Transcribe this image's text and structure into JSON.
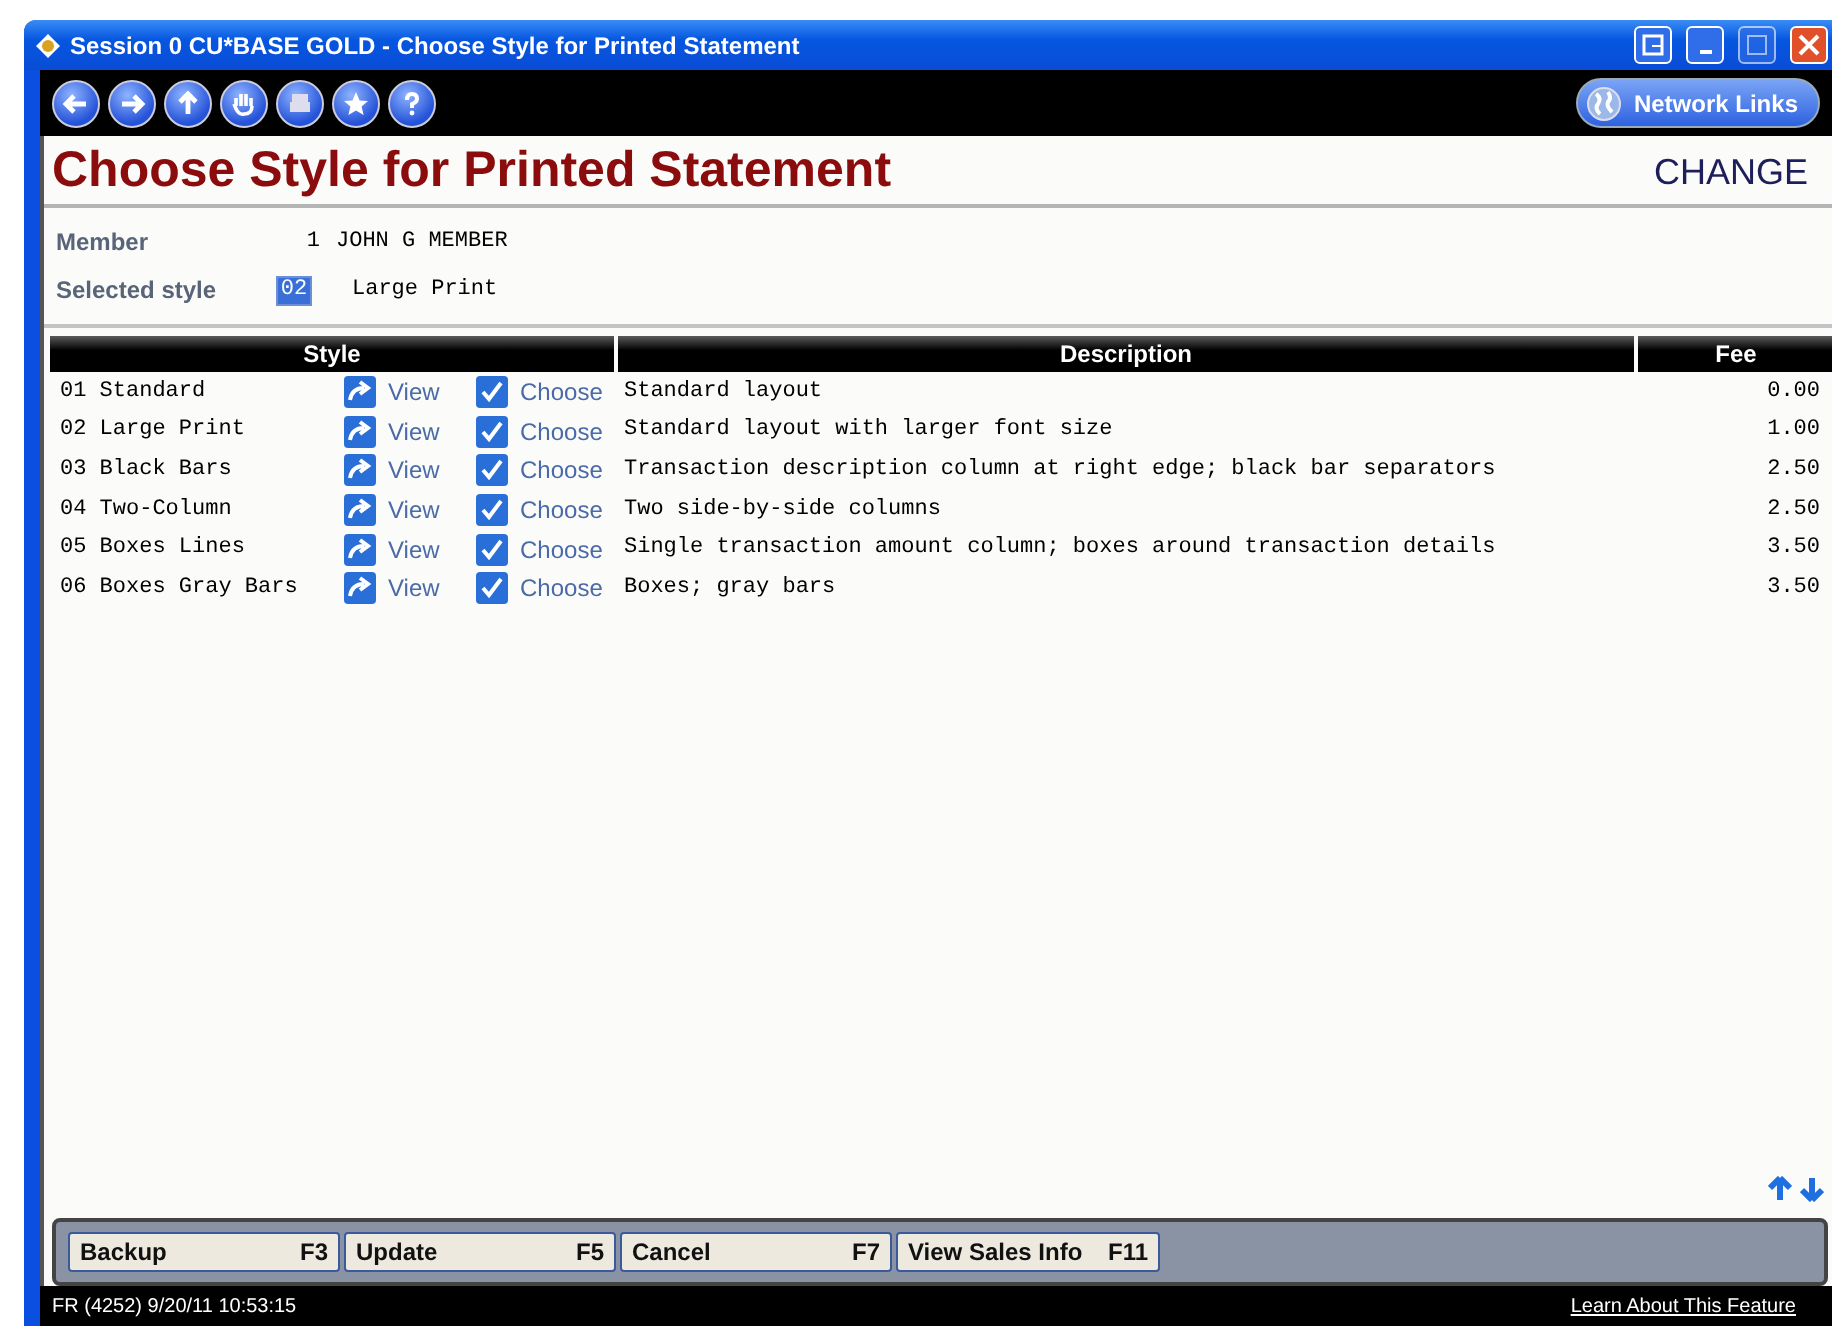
{
  "window": {
    "title": "Session 0 CU*BASE GOLD - Choose Style for Printed Statement"
  },
  "toolbar": {
    "buttons": [
      {
        "kind": "back"
      },
      {
        "kind": "forward"
      },
      {
        "kind": "up"
      },
      {
        "kind": "hand"
      },
      {
        "kind": "print"
      },
      {
        "kind": "star"
      },
      {
        "kind": "help"
      }
    ],
    "network_links": "Network Links"
  },
  "page": {
    "title": "Choose Style for Printed Statement",
    "mode": "CHANGE"
  },
  "member": {
    "label": "Member",
    "number": "1",
    "name": "JOHN G MEMBER"
  },
  "selected_style": {
    "label": "Selected style",
    "value": "02",
    "name": "Large Print"
  },
  "table": {
    "columns": [
      "Style",
      "Description",
      "Fee"
    ],
    "rows": [
      {
        "style": "01 Standard",
        "view": "View",
        "choose": "Choose",
        "description": "Standard layout",
        "fee": "0.00"
      },
      {
        "style": "02 Large Print",
        "view": "View",
        "choose": "Choose",
        "description": "Standard layout with larger font size",
        "fee": "1.00"
      },
      {
        "style": "03 Black Bars",
        "view": "View",
        "choose": "Choose",
        "description": "Transaction description column at right edge; black bar separators",
        "fee": "2.50"
      },
      {
        "style": "04 Two-Column",
        "view": "View",
        "choose": "Choose",
        "description": "Two side-by-side columns",
        "fee": "2.50"
      },
      {
        "style": "05 Boxes Lines",
        "view": "View",
        "choose": "Choose",
        "description": "Single transaction amount column; boxes around transaction details",
        "fee": "3.50"
      },
      {
        "style": "06 Boxes Gray Bars",
        "view": "View",
        "choose": "Choose",
        "description": "Boxes; gray bars",
        "fee": "3.50"
      }
    ]
  },
  "function_keys": [
    {
      "label": "Backup",
      "key": "F3"
    },
    {
      "label": "Update",
      "key": "F5"
    },
    {
      "label": "Cancel",
      "key": "F7"
    },
    {
      "label": "View Sales Info",
      "key": "F11"
    }
  ],
  "status_bar": {
    "info": "FR (4252) 9/20/11 10:53:15",
    "link": "Learn About This Feature"
  }
}
